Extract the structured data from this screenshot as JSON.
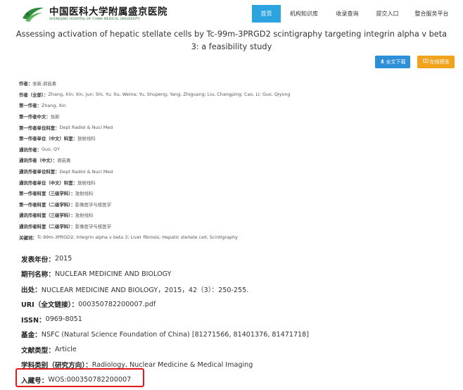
{
  "header": {
    "logo_cn": "中国医科大学附属盛京医院",
    "logo_en": "SHENGJING HOSPITAL OF CHINA MEDICAL UNIVERSITY",
    "nav": [
      {
        "label": "首页",
        "active": true
      },
      {
        "label": "机构知识库",
        "active": false
      },
      {
        "label": "收录查询",
        "active": false
      },
      {
        "label": "提交入口",
        "active": false
      },
      {
        "label": "整合服务平台",
        "active": false
      }
    ]
  },
  "title": "Assessing activation of hepatic stellate cells by Tc-99m-3PRGD2 scintigraphy targeting integrin alpha v beta 3: a feasibility study",
  "buttons": {
    "download": "全文下载",
    "preview": "在线预览"
  },
  "meta": [
    {
      "label": "作者：",
      "value": "张新,郭启勇"
    },
    {
      "label": "作者（全部）：",
      "value": "Zhang, Xin; Xin, Jun; Shi, Yu; Xu, Weina; Yu, Shupeng; Yang, Zhiguang; Liu, Changping; Cao, Li; Guo, Qiyong"
    },
    {
      "label": "第一作者：",
      "value": "Zhang, Xin"
    },
    {
      "label": "第一作者中文：",
      "value": "张新"
    },
    {
      "label": "第一作者单位科室：",
      "value": "Dept Radiol & Nucl Med"
    },
    {
      "label": "第一作者单位（中文）科室：",
      "value": "放射线科"
    },
    {
      "label": "通讯作者：",
      "value": "Guo, QY"
    },
    {
      "label": "通讯作者（中文）：",
      "value": "郭启勇"
    },
    {
      "label": "通讯作者单位科室：",
      "value": "Dept Radiol & Nucl Med"
    },
    {
      "label": "通讯作者单位（中文）科室：",
      "value": "放射线科"
    },
    {
      "label": "第一作者科室（三级学科）：",
      "value": "放射线科"
    },
    {
      "label": "第一作者科室（二级学科）：",
      "value": "影像医学与核医学"
    },
    {
      "label": "通讯作者科室（三级学科）：",
      "value": "放射线科"
    },
    {
      "label": "通讯作者科室（二级学科）：",
      "value": "影像医学与核医学"
    },
    {
      "label": "关键词：",
      "value": "Tc-99m-3PRGD2; Integrin alpha v beta 3; Liver fibrosis; Hepatic stellate cell; Scintigraphy"
    }
  ],
  "details": [
    {
      "label": "发表年份：",
      "value": "2015"
    },
    {
      "label": "期刊名称：",
      "value": "NUCLEAR MEDICINE AND BIOLOGY"
    },
    {
      "label": "出处：",
      "value": "NUCLEAR MEDICINE AND BIOLOGY，2015，42（3）：250-255."
    },
    {
      "label": "URI（全文链接）：",
      "value": "000350782200007.pdf"
    },
    {
      "label": "ISSN：",
      "value": "0969-8051"
    },
    {
      "label": "基金：",
      "value": "NSFC (Natural Science Foundation of China) [81271566, 81401376, 81471718]"
    },
    {
      "label": "文献类型：",
      "value": "Article"
    },
    {
      "label": "学科类别（研究方向）：",
      "value": "Radiology, Nuclear Medicine & Medical Imaging"
    },
    {
      "label": "入藏号：",
      "value": "WOS:000350782200007"
    }
  ],
  "colors": {
    "nav_active": "#2ba4e0",
    "download_button": "#2c8fd8",
    "preview_button": "#f1a31e",
    "highlight_border": "#e0191b",
    "logo_green": "#2a6e3a"
  },
  "icons": {
    "logo": "hospital-logo",
    "download": "download-icon",
    "preview": "book-icon"
  }
}
